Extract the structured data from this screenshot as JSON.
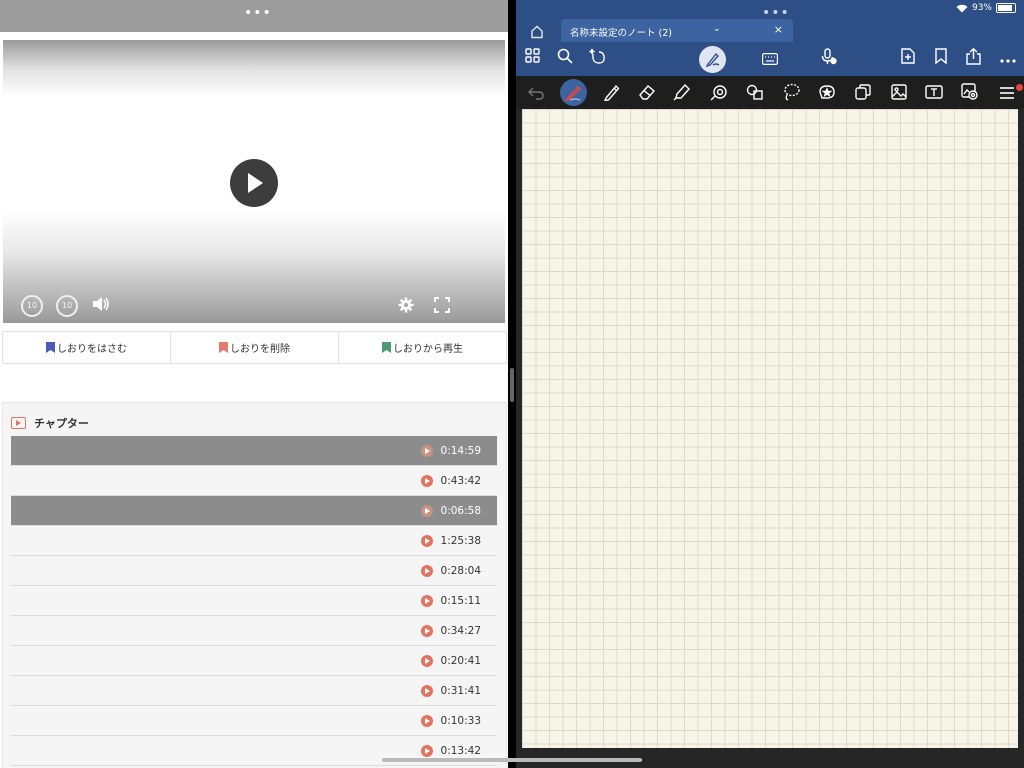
{
  "left": {
    "bookmarks": [
      "しおりをはさむ",
      "しおりを削除",
      "しおりから再生"
    ],
    "video": {
      "skip_back": "10",
      "skip_fwd": "10"
    },
    "chapter_title": "チャプター",
    "chapters": [
      {
        "time": "0:14:59",
        "highlighted": true
      },
      {
        "time": "0:43:42",
        "highlighted": false
      },
      {
        "time": "0:06:58",
        "highlighted": true
      },
      {
        "time": "1:25:38",
        "highlighted": false
      },
      {
        "time": "0:28:04",
        "highlighted": false
      },
      {
        "time": "0:15:11",
        "highlighted": false
      },
      {
        "time": "0:34:27",
        "highlighted": false
      },
      {
        "time": "0:20:41",
        "highlighted": false
      },
      {
        "time": "0:31:41",
        "highlighted": false
      },
      {
        "time": "0:10:33",
        "highlighted": false
      },
      {
        "time": "0:13:42",
        "highlighted": false
      }
    ]
  },
  "right": {
    "battery": "93%",
    "tab_title": "名称未設定のノート (2)",
    "tab_close": "×"
  },
  "colors": {
    "accent": "#2e4f85",
    "chapter_play": "#e2735f",
    "paper": "#f7f5e8"
  }
}
